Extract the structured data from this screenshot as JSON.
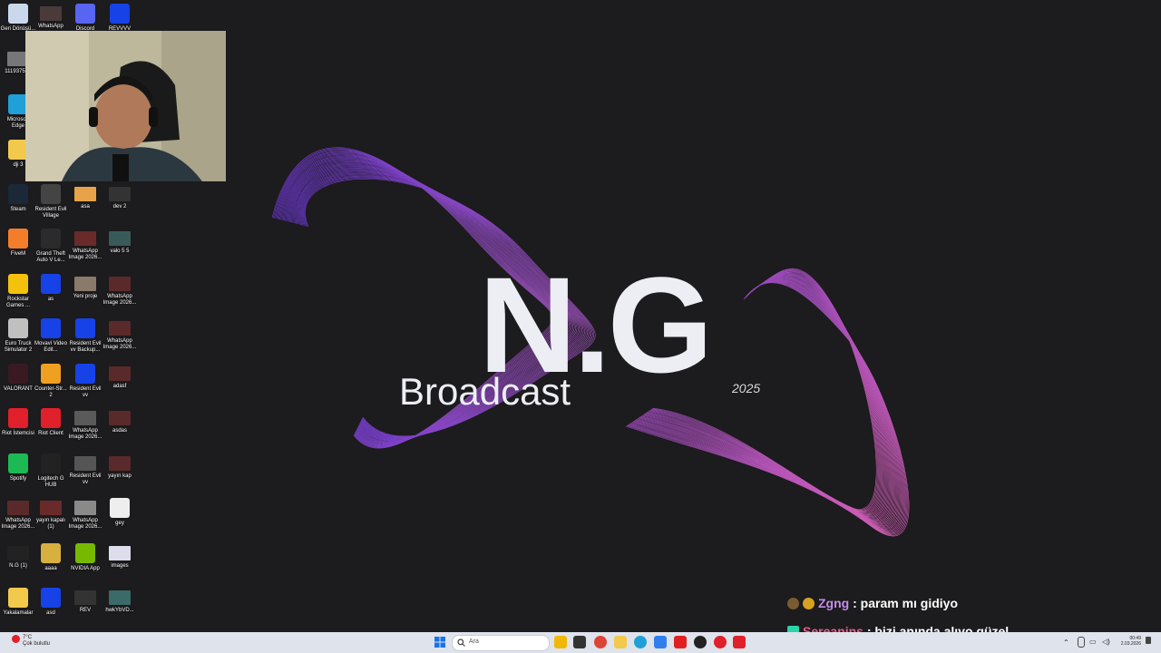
{
  "wallpaper": {
    "logo": "N.G",
    "subtitle": "Broadcast",
    "year": "2025"
  },
  "desktop_icons": [
    {
      "label": "Geri Dönüşü...",
      "icon": "recycle-bin-icon",
      "color": "#c9d8ec"
    },
    {
      "label": "WhatsApp",
      "icon": "image-icon",
      "color": "#4a3a3a"
    },
    {
      "label": "Discord",
      "icon": "discord-icon",
      "color": "#5865f2"
    },
    {
      "label": "REVVVV",
      "icon": "app-icon",
      "color": "#1742e8"
    },
    {
      "label": "1119375-...",
      "icon": "image-icon",
      "color": "#777777"
    },
    {
      "label": "Microsoft Edge",
      "icon": "edge-icon",
      "color": "#1fa0d8"
    },
    {
      "label": "dji 3",
      "icon": "folder-icon",
      "color": "#f2c94c"
    },
    {
      "label": "Steam",
      "icon": "steam-icon",
      "color": "#1b2838"
    },
    {
      "label": "Resident Evil Village",
      "icon": "game-icon",
      "color": "#444444"
    },
    {
      "label": "asa",
      "icon": "image-icon",
      "color": "#e8a24a"
    },
    {
      "label": "dev 2",
      "icon": "video-icon",
      "color": "#333333"
    },
    {
      "label": "FiveM",
      "icon": "fivem-icon",
      "color": "#f37d2a"
    },
    {
      "label": "Grand Theft Auto V Le...",
      "icon": "gta-icon",
      "color": "#2b2b2b"
    },
    {
      "label": "WhatsApp Image 2026...",
      "icon": "image-icon",
      "color": "#6b2a2a"
    },
    {
      "label": "valo 5 5",
      "icon": "video-icon",
      "color": "#3a5a5a"
    },
    {
      "label": "Rockstar Games ...",
      "icon": "rockstar-icon",
      "color": "#f4c20d"
    },
    {
      "label": "as",
      "icon": "app-icon",
      "color": "#1742e8"
    },
    {
      "label": "Yeni proje",
      "icon": "image-icon",
      "color": "#8a7a6a"
    },
    {
      "label": "WhatsApp Image 2026...",
      "icon": "image-icon",
      "color": "#5a2a2a"
    },
    {
      "label": "Euro Truck Simulator 2",
      "icon": "truck-icon",
      "color": "#c0c0c0"
    },
    {
      "label": "Movavi Video Edit...",
      "icon": "app-icon",
      "color": "#1742e8"
    },
    {
      "label": "Resident Evil vv Backup...",
      "icon": "app-icon",
      "color": "#1742e8"
    },
    {
      "label": "WhatsApp Image 2026...",
      "icon": "image-icon",
      "color": "#5a2a2a"
    },
    {
      "label": "VALORANT",
      "icon": "valorant-icon",
      "color": "#3a1a22"
    },
    {
      "label": "Counter-Str... 2",
      "icon": "cs2-icon",
      "color": "#f0a020"
    },
    {
      "label": "Resident Evil vv",
      "icon": "app-icon",
      "color": "#1742e8"
    },
    {
      "label": "adasf",
      "icon": "image-icon",
      "color": "#5a2a2a"
    },
    {
      "label": "Riot İstemcisi",
      "icon": "riot-icon",
      "color": "#e0202a"
    },
    {
      "label": "Riot Client",
      "icon": "riot-icon",
      "color": "#e0202a"
    },
    {
      "label": "WhatsApp Image 2026...",
      "icon": "image-icon",
      "color": "#5a5a5a"
    },
    {
      "label": "asdas",
      "icon": "image-icon",
      "color": "#5a2a2a"
    },
    {
      "label": "Spotify",
      "icon": "spotify-icon",
      "color": "#1db954"
    },
    {
      "label": "Logitech G HUB",
      "icon": "logitech-icon",
      "color": "#222222"
    },
    {
      "label": "Resident Evil vv",
      "icon": "video-icon",
      "color": "#555555"
    },
    {
      "label": "yayın kap",
      "icon": "image-icon",
      "color": "#5a2a2a"
    },
    {
      "label": "WhatsApp Image 2026...",
      "icon": "image-icon",
      "color": "#5a2a2a"
    },
    {
      "label": "yayın kapalı (1)",
      "icon": "image-icon",
      "color": "#6a2a2a"
    },
    {
      "label": "WhatsApp Image 2026...",
      "icon": "image-icon",
      "color": "#8a8a8a"
    },
    {
      "label": "gey",
      "icon": "media-player-icon",
      "color": "#eeeeee"
    },
    {
      "label": "N.G (1)",
      "icon": "image-icon",
      "color": "#222222"
    },
    {
      "label": "aaaa",
      "icon": "folder-icon",
      "color": "#d8b040"
    },
    {
      "label": "NVIDIA App",
      "icon": "nvidia-icon",
      "color": "#76b900"
    },
    {
      "label": "images",
      "icon": "image-icon",
      "color": "#ddddee"
    },
    {
      "label": "Yakalamalar",
      "icon": "folder-icon",
      "color": "#f2c94c"
    },
    {
      "label": "asd",
      "icon": "app-icon",
      "color": "#1742e8"
    },
    {
      "label": "REV",
      "icon": "video-icon",
      "color": "#333333"
    },
    {
      "label": "hwkYbVD...",
      "icon": "image-icon",
      "color": "#3a6a6a"
    }
  ],
  "chat": [
    {
      "user": "Zgng",
      "text": ": param mı gidiyo",
      "user_color": "#c48de8",
      "badge": "moderator-badge-icon"
    },
    {
      "user": "Sereanins",
      "text": ": bizi anında alıyo güzel",
      "user_color": "#e85c8a",
      "badge": "verified-badge-icon"
    }
  ],
  "taskbar": {
    "weather_temp": "7°C",
    "weather_desc": "Çok bulutlu",
    "search_placeholder": "Ara",
    "time": "00:49",
    "date": "2.03.2026",
    "apps": [
      {
        "icon": "file-explorer-icon",
        "color": "#f2b705"
      },
      {
        "icon": "task-view-icon",
        "color": "#333333"
      },
      {
        "icon": "chrome-icon",
        "color": "#db4437"
      },
      {
        "icon": "folder-icon",
        "color": "#f2c94c"
      },
      {
        "icon": "edge-icon",
        "color": "#1fa0d8"
      },
      {
        "icon": "store-icon",
        "color": "#2f80ed"
      },
      {
        "icon": "youtube-icon",
        "color": "#e02020"
      },
      {
        "icon": "obs-icon",
        "color": "#222222"
      },
      {
        "icon": "opera-icon",
        "color": "#e0202a"
      },
      {
        "icon": "valorant-icon",
        "color": "#e0202a"
      }
    ]
  }
}
